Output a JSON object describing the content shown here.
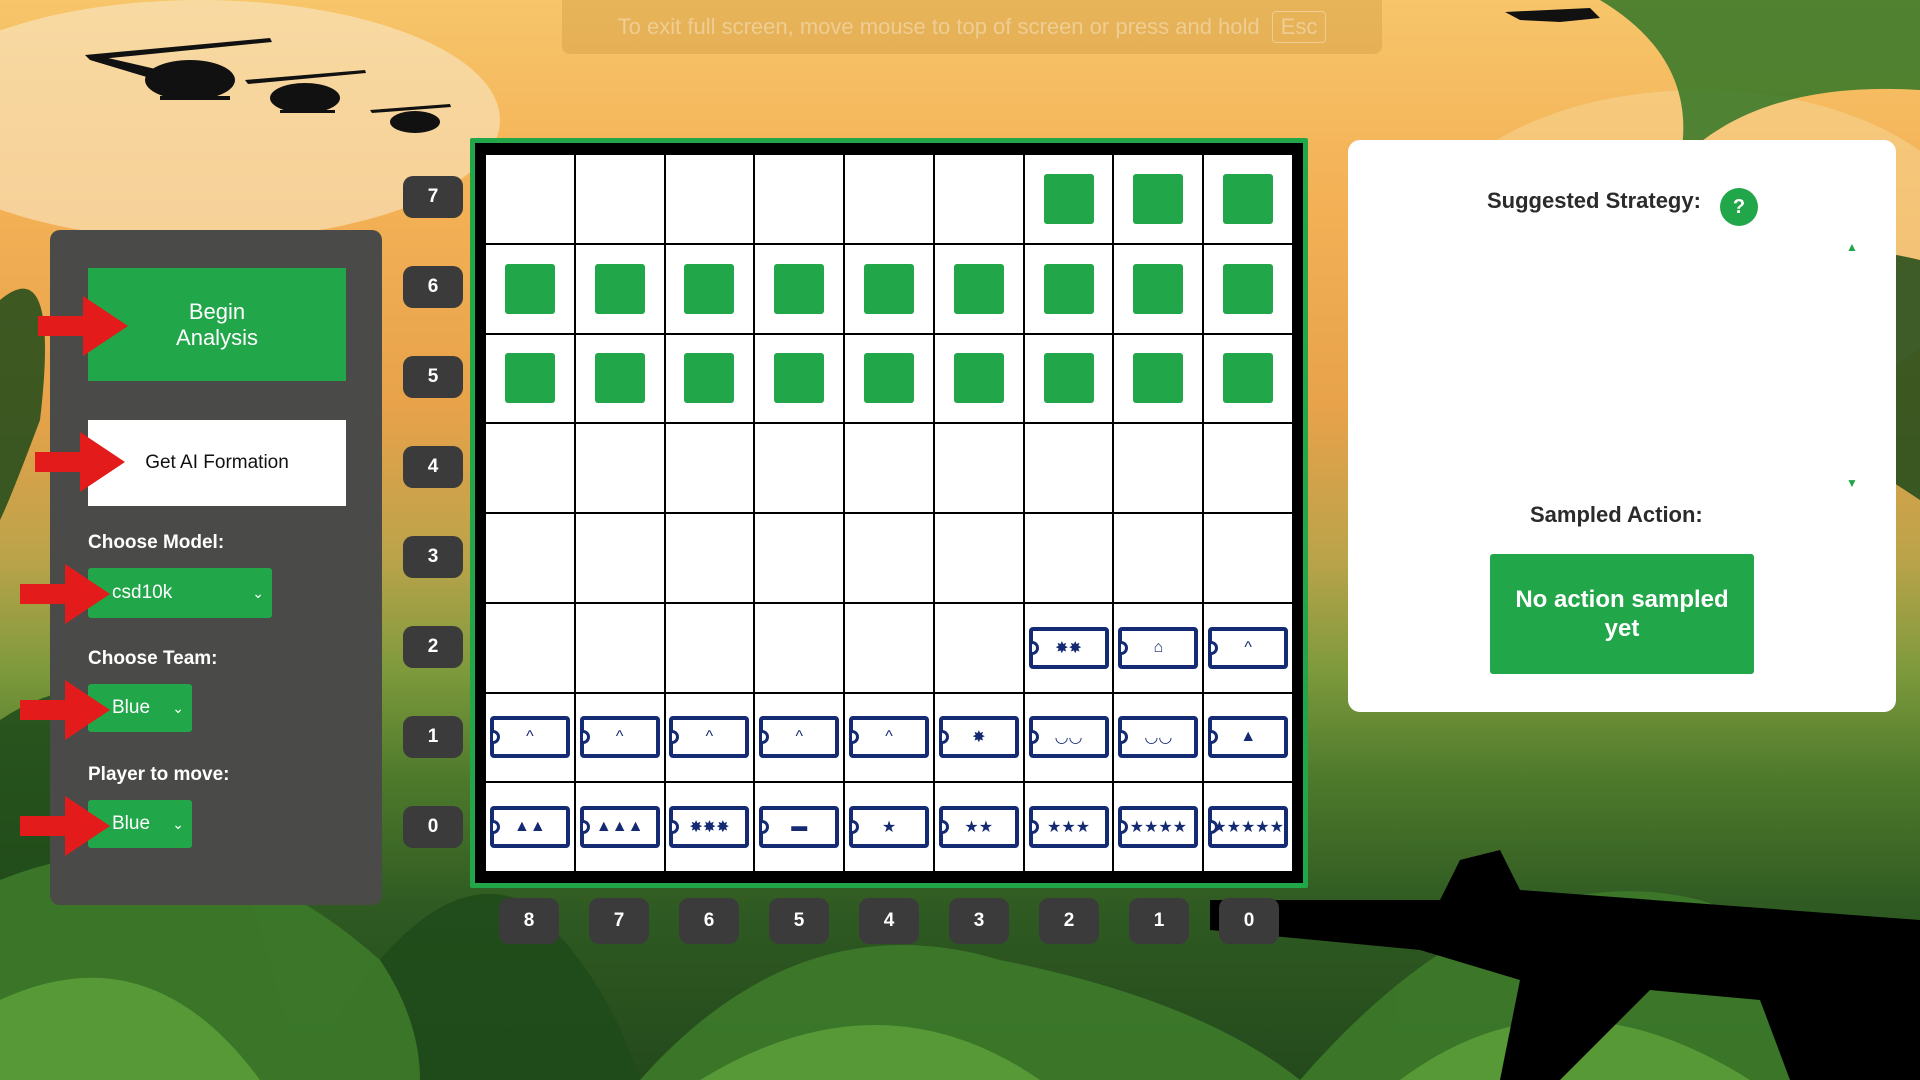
{
  "fullscreen_banner": {
    "text": "To exit full screen, move mouse to top of screen or press and hold",
    "key": "Esc"
  },
  "controls": {
    "begin_label": "Begin\nAnalysis",
    "ai_formation_label": "Get AI Formation",
    "model_label": "Choose Model:",
    "model_value": "csd10k",
    "team_label": "Choose Team:",
    "team_value": "Blue",
    "player_label": "Player to move:",
    "player_value": "Blue"
  },
  "board": {
    "ranks": [
      "7",
      "6",
      "5",
      "4",
      "3",
      "2",
      "1",
      "0"
    ],
    "files": [
      "8",
      "7",
      "6",
      "5",
      "4",
      "3",
      "2",
      "1",
      "0"
    ],
    "rows": [
      [
        "",
        "",
        "",
        "",
        "",
        "",
        "G",
        "G",
        "G"
      ],
      [
        "G",
        "G",
        "G",
        "G",
        "G",
        "G",
        "G",
        "G",
        "G"
      ],
      [
        "G",
        "G",
        "G",
        "G",
        "G",
        "G",
        "G",
        "G",
        "G"
      ],
      [
        "",
        "",
        "",
        "",
        "",
        "",
        "",
        "",
        ""
      ],
      [
        "",
        "",
        "",
        "",
        "",
        "",
        "",
        "",
        ""
      ],
      [
        "",
        "",
        "",
        "",
        "",
        "",
        "✸✸",
        "⌂",
        "^"
      ],
      [
        "^",
        "^",
        "^",
        "^",
        "^",
        "✸",
        "◡◡",
        "◡◡",
        "▲"
      ],
      [
        "▲▲",
        "▲▲▲",
        "✸✸✸",
        "▬",
        "★",
        "★★",
        "★★★",
        "★★★★",
        "★★★★★"
      ]
    ]
  },
  "strategy": {
    "title": "Suggested Strategy:",
    "help": "?",
    "sampled_title": "Sampled Action:",
    "action_label": "No action sampled yet"
  },
  "colors": {
    "accent": "#22a64a",
    "piece_blue": "#142a72",
    "panel": "#4a4a48"
  }
}
